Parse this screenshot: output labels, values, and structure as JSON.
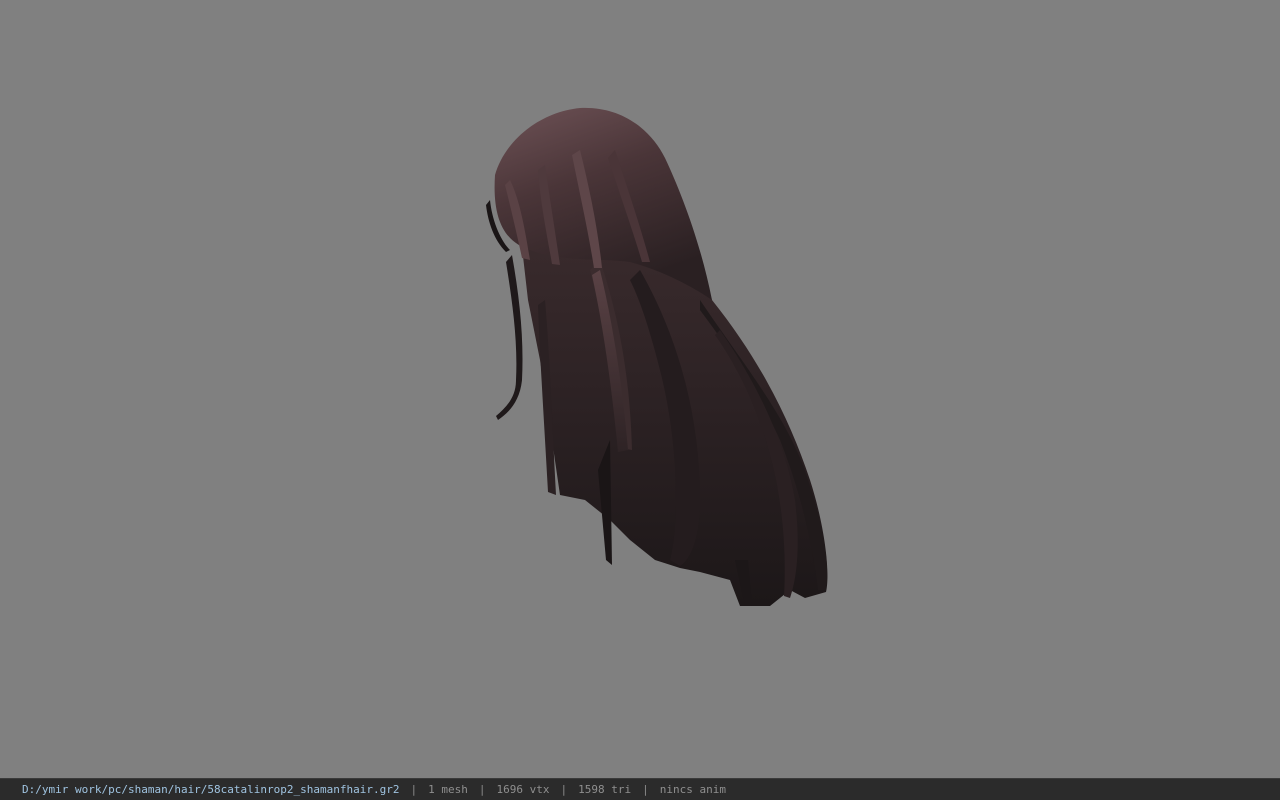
{
  "viewer": {
    "background_color": "#808080",
    "model_name": "hair-mesh",
    "hair_color_light": "#6b4f52",
    "hair_color_dark": "#1a1516"
  },
  "status_bar": {
    "file_path": "D:/ymir work/pc/shaman/hair/58catalinrop2_shamanfhair.gr2",
    "separator": "|",
    "mesh_count": "1 mesh",
    "vertex_count": "1696 vtx",
    "triangle_count": "1598 tri",
    "anim_status": "nincs anim"
  }
}
